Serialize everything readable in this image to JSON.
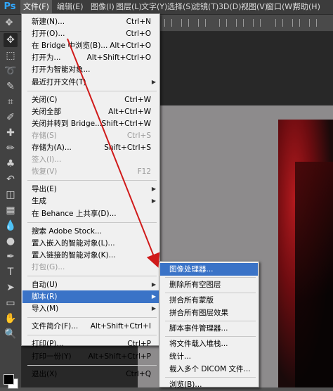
{
  "app": {
    "logo": "Ps"
  },
  "menubar": [
    {
      "label": "文件(F)",
      "active": true
    },
    {
      "label": "编辑(E)"
    },
    {
      "label": "图像(I)"
    },
    {
      "label": "图层(L)"
    },
    {
      "label": "文字(Y)"
    },
    {
      "label": "选择(S)"
    },
    {
      "label": "滤镜(T)"
    },
    {
      "label": "3D(D)"
    },
    {
      "label": "视图(V)"
    },
    {
      "label": "窗口(W)"
    },
    {
      "label": "帮助(H)"
    }
  ],
  "file_menu": [
    {
      "label": "新建(N)...",
      "shortcut": "Ctrl+N"
    },
    {
      "label": "打开(O)...",
      "shortcut": "Ctrl+O"
    },
    {
      "label": "在 Bridge 中浏览(B)...",
      "shortcut": "Alt+Ctrl+O"
    },
    {
      "label": "打开为...",
      "shortcut": "Alt+Shift+Ctrl+O"
    },
    {
      "label": "打开为智能对象..."
    },
    {
      "label": "最近打开文件(T)",
      "submenu": true
    },
    {
      "separator": true
    },
    {
      "label": "关闭(C)",
      "shortcut": "Ctrl+W"
    },
    {
      "label": "关闭全部",
      "shortcut": "Alt+Ctrl+W"
    },
    {
      "label": "关闭并转到 Bridge...",
      "shortcut": "Shift+Ctrl+W"
    },
    {
      "label": "存储(S)",
      "shortcut": "Ctrl+S",
      "disabled": true
    },
    {
      "label": "存储为(A)...",
      "shortcut": "Shift+Ctrl+S"
    },
    {
      "label": "签入(I)...",
      "disabled": true
    },
    {
      "label": "恢复(V)",
      "shortcut": "F12",
      "disabled": true
    },
    {
      "separator": true
    },
    {
      "label": "导出(E)",
      "submenu": true
    },
    {
      "label": "生成",
      "submenu": true
    },
    {
      "label": "在 Behance 上共享(D)..."
    },
    {
      "separator": true
    },
    {
      "label": "搜索 Adobe Stock..."
    },
    {
      "label": "置入嵌入的智能对象(L)..."
    },
    {
      "label": "置入链接的智能对象(K)..."
    },
    {
      "label": "打包(G)...",
      "disabled": true
    },
    {
      "separator": true
    },
    {
      "label": "自动(U)",
      "submenu": true
    },
    {
      "label": "脚本(R)",
      "submenu": true,
      "highlighted": true
    },
    {
      "label": "导入(M)",
      "submenu": true
    },
    {
      "separator": true
    },
    {
      "label": "文件简介(F)...",
      "shortcut": "Alt+Shift+Ctrl+I"
    },
    {
      "separator": true
    },
    {
      "label": "打印(P)...",
      "shortcut": "Ctrl+P"
    },
    {
      "label": "打印一份(Y)",
      "shortcut": "Alt+Shift+Ctrl+P"
    },
    {
      "separator": true
    },
    {
      "label": "退出(X)",
      "shortcut": "Ctrl+Q"
    }
  ],
  "script_submenu": [
    {
      "label": "图像处理器...",
      "highlighted": true
    },
    {
      "separator": true
    },
    {
      "label": "删除所有空图层"
    },
    {
      "separator": true
    },
    {
      "label": "拼合所有蒙版"
    },
    {
      "label": "拼合所有图层效果"
    },
    {
      "separator": true
    },
    {
      "label": "脚本事件管理器..."
    },
    {
      "separator": true
    },
    {
      "label": "将文件载入堆栈..."
    },
    {
      "label": "统计..."
    },
    {
      "label": "载入多个 DICOM 文件..."
    },
    {
      "separator": true
    },
    {
      "label": "浏览(B)..."
    }
  ],
  "tools": [
    "move-tool",
    "marquee-tool",
    "lasso-tool",
    "quick-select-tool",
    "crop-tool",
    "eyedropper-tool",
    "healing-tool",
    "brush-tool",
    "stamp-tool",
    "history-brush-tool",
    "eraser-tool",
    "gradient-tool",
    "blur-tool",
    "dodge-tool",
    "pen-tool",
    "type-tool",
    "path-select-tool",
    "shape-tool",
    "hand-tool",
    "zoom-tool"
  ],
  "colors": {
    "accent": "#3a73c7",
    "annotation_arrow": "#d01a1a",
    "foreground": "#000000",
    "background": "#ffffff"
  }
}
